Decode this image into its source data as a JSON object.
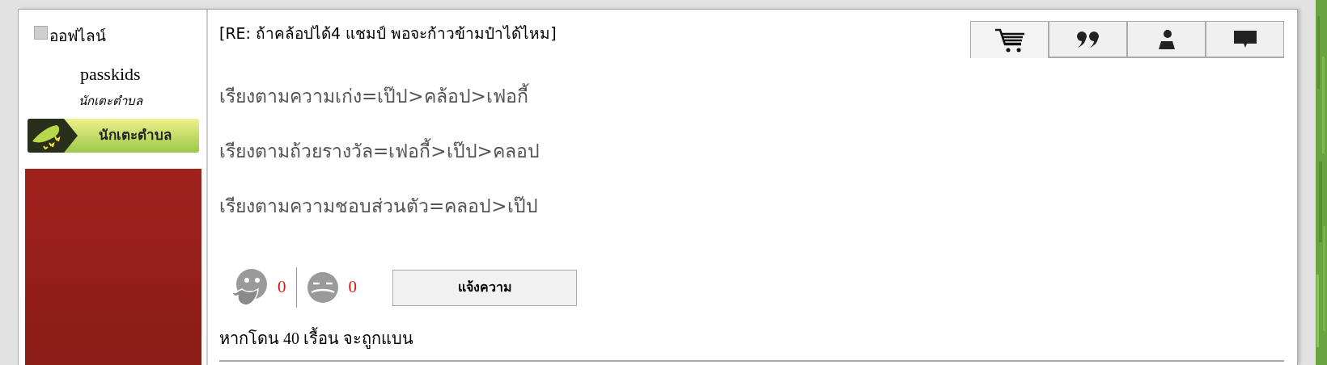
{
  "user": {
    "status": {
      "label": "ออฟไลน์",
      "online": false
    },
    "name": "passkids",
    "rank": "นักเตะตำบล",
    "rank_badge": "นักเตะตำบล"
  },
  "post": {
    "title": "[RE: ถ้าคล้อปได้4 แชมป์ พอจะก้าวข้ามป๋าได้ไหม]",
    "tabs": [
      {
        "selected": true
      },
      {
        "selected": false
      },
      {
        "selected": false
      },
      {
        "selected": false
      }
    ],
    "lines": [
      "เรียงตามความเก่ง=เป๊ป>คล้อป>เฟอกี้",
      "เรียงตามถ้วยรางวัล=เฟอกี้>เป๊ป>คลอป",
      "เรียงตามความชอบส่วนตัว=คลอป>เป๊ป"
    ],
    "reactions": [
      {
        "count": "0"
      },
      {
        "count": "0"
      }
    ],
    "report_button": "แจ้งความ",
    "note": "หากโดน 40 เรื้อน จะถูกแบน"
  }
}
